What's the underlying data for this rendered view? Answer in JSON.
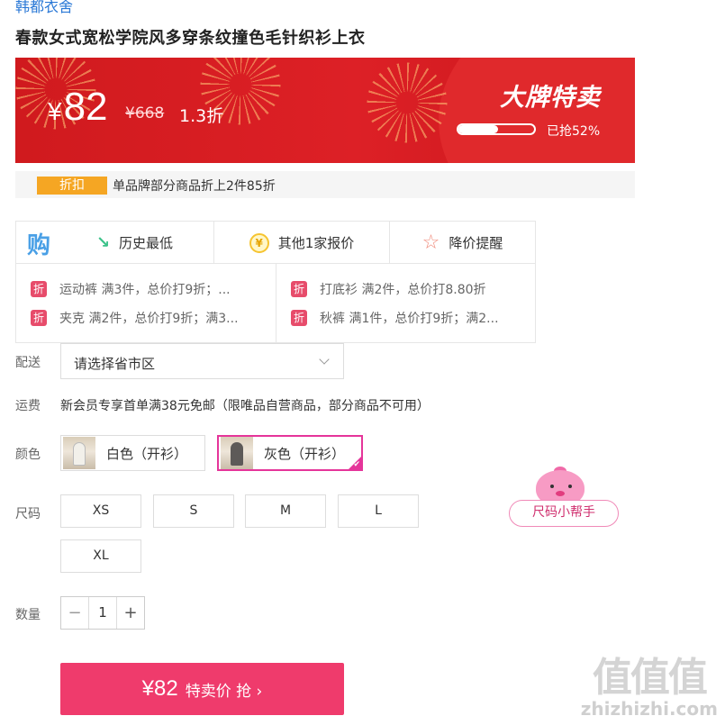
{
  "brand": "韩都衣舍",
  "title": "春款女式宽松学院风多穿条纹撞色毛针织衫上衣",
  "banner": {
    "currency": "¥",
    "price": "82",
    "original_price": "¥668",
    "discount": "1.3折",
    "sale_tag": "大牌特卖",
    "grabbed_text": "已抢52%",
    "grabbed_fraction": 0.52
  },
  "promo": {
    "badge": "折扣",
    "text": "单品牌部分商品折上2件85折"
  },
  "info": {
    "logo_char": "购",
    "lowest_price": "历史最低",
    "other_quotes": "其他1家报价",
    "price_alert": "降价提醒",
    "coin_symbol": "¥",
    "offer_badge": "折",
    "offers": [
      "运动裤 满3件，总价打9折；...",
      "打底衫 满2件，总价打8.80折",
      "夹克 满2件，总价打9折；满3...",
      "秋裤 满1件，总价打9折；满2..."
    ]
  },
  "labels": {
    "delivery": "配送",
    "shipping": "运费",
    "color": "颜色",
    "size": "尺码",
    "quantity": "数量"
  },
  "delivery": {
    "placeholder": "请选择省市区"
  },
  "shipping_text": "新会员专享首单满38元免邮（限唯品自营商品，部分商品不可用）",
  "colors": [
    {
      "label": "白色（开衫）",
      "selected": false
    },
    {
      "label": "灰色（开衫）",
      "selected": true
    }
  ],
  "sizes": [
    "XS",
    "S",
    "M",
    "L",
    "XL"
  ],
  "size_helper": "尺码小帮手",
  "quantity": {
    "value": "1",
    "minus": "−",
    "plus": "+"
  },
  "buy_button": {
    "price": "¥82",
    "text": "特卖价 抢 ›"
  },
  "watermark": {
    "big": "值值值",
    "small": "zhizhizhi.com"
  },
  "accent_colors": {
    "banner_red": "#d01a1e",
    "pink": "#ef3b6c",
    "promo_orange": "#f5a623",
    "selected_border": "#e5359a"
  }
}
